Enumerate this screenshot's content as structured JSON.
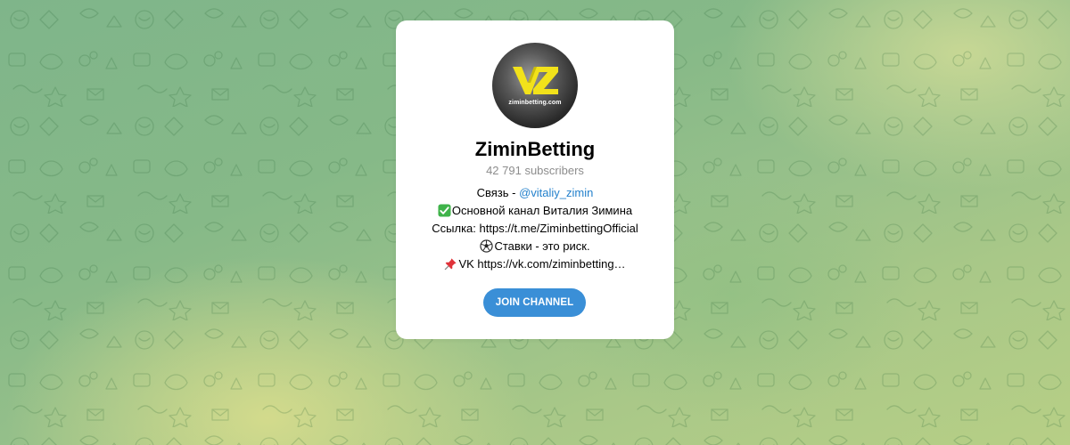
{
  "channel": {
    "name": "ZiminBetting",
    "subscribers": "42 791 subscribers",
    "avatar_text": "ziminbetting.com",
    "avatar_logo": "VZ"
  },
  "description": {
    "line1_prefix": "Связь - ",
    "line1_link": "@vitaliy_zimin",
    "line2_icon": "check-mark-icon",
    "line2_text": "Основной канал Виталия Зимина",
    "line3_text": "Ссылка: https://t.me/ZiminbettingOfficial",
    "line4_icon": "soccer-ball-icon",
    "line4_text": "Ставки - это риск.",
    "line5_icon": "pushpin-icon",
    "line5_text": "VK https://vk.com/ziminbetting…"
  },
  "actions": {
    "join_label": "JOIN CHANNEL"
  },
  "colors": {
    "accent": "#3a8fd7",
    "link": "#2481cc",
    "logo_yellow": "#f2e21a"
  }
}
